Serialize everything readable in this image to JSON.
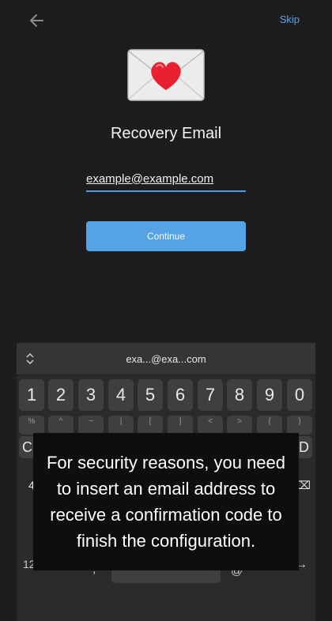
{
  "header": {
    "skip_label": "Skip"
  },
  "main": {
    "title": "Recovery Email",
    "email_value": "example@example.com",
    "continue_label": "Continue"
  },
  "keyboard": {
    "suggestion": "exa...@exa...com",
    "number_keys": [
      "1",
      "2",
      "3",
      "4",
      "5",
      "6",
      "7",
      "8",
      "9",
      "0"
    ],
    "symbol_keys": [
      "%",
      "^",
      "~",
      "|",
      "[",
      "]",
      "<",
      ">",
      "{",
      "}"
    ],
    "partial_left": "C",
    "partial_right": "D",
    "partial_left_row3": "4",
    "partial_right_row3": "⌫",
    "bottom_left": "12",
    "bottom_comma": ",",
    "bottom_at": "@",
    "bottom_dot": ".",
    "bottom_arrow": "→"
  },
  "tooltip": {
    "text": "For security reasons, you need to insert an email address to receive a confirmation code to finish the configuration."
  },
  "colors": {
    "accent": "#55a2e4",
    "link": "#58a6e8",
    "background": "#1d1d1f"
  }
}
